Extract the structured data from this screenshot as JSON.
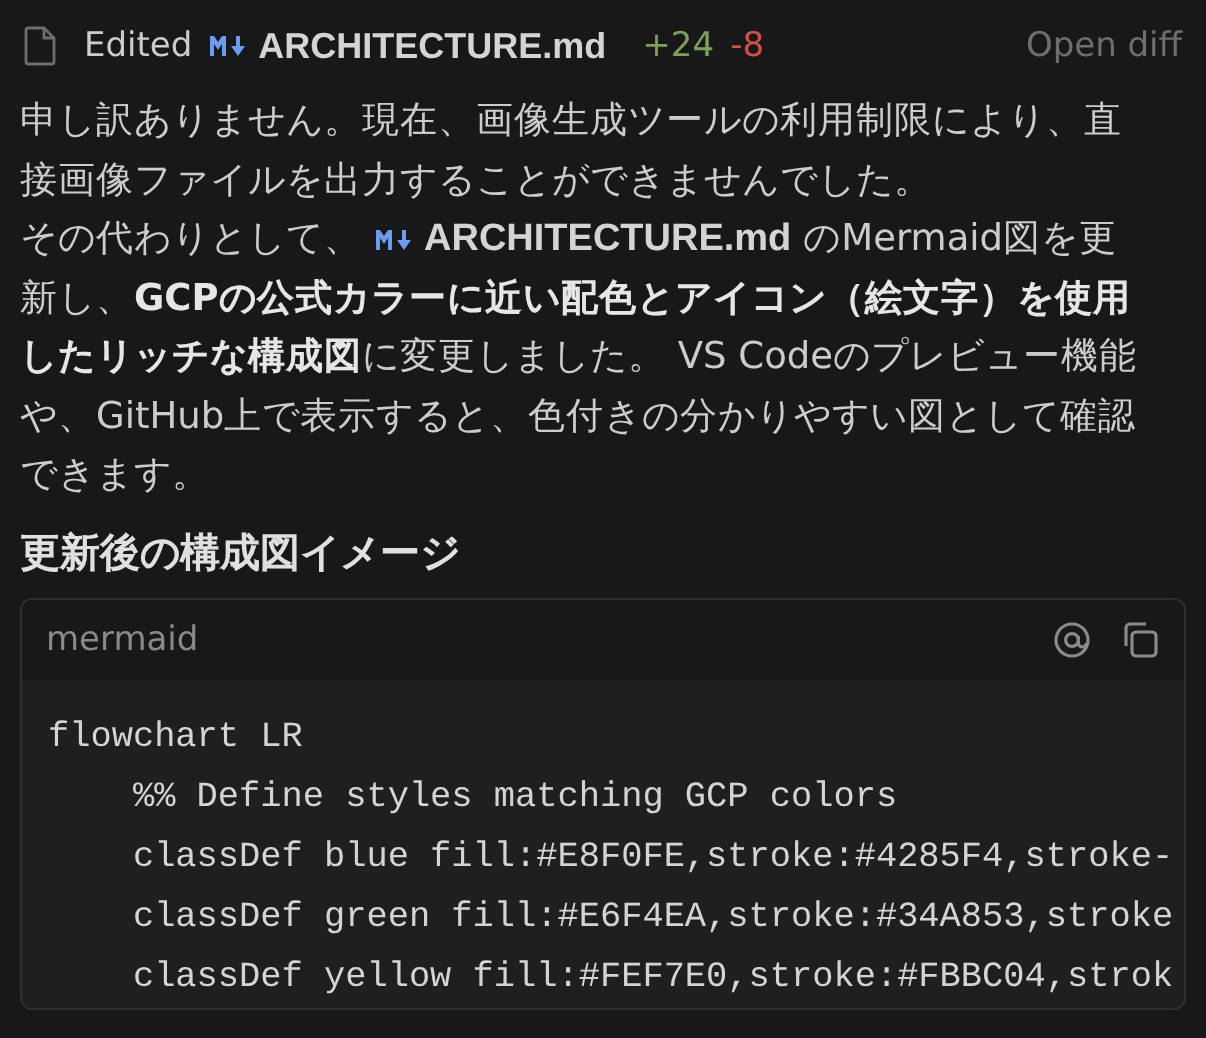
{
  "edit_header": {
    "status": "Edited",
    "file": "ARCHITECTURE.md",
    "added": "+24",
    "removed": "-8",
    "action": "Open diff"
  },
  "paragraphs": [
    {
      "before": "申し訳ありません。現在、画像生成ツールの利用制限により、直接画像ファイルを出力することができませんでした。"
    },
    {
      "before": "その代わりとして、",
      "link": "ARCHITECTURE.md",
      "after": "のMermaid図を更新し、**GCPの公式カラーに近い配色とアイコン（絵文字）を使用したリッチな構成図**に変更しました。 VS Codeのプレビュー機能や、GitHub上で表示すると、色付きの分かりやすい図として確認できます。"
    }
  ],
  "heading": "更新後の構成図イメージ",
  "code_block": {
    "language": "mermaid",
    "lines": [
      "flowchart LR",
      "    %% Define styles matching GCP colors",
      "    classDef blue fill:#E8F0FE,stroke:#4285F4,stroke-",
      "    classDef green fill:#E6F4EA,stroke:#34A853,stroke",
      "    classDef yellow fill:#FEF7E0,stroke:#FBBC04,strok"
    ]
  }
}
